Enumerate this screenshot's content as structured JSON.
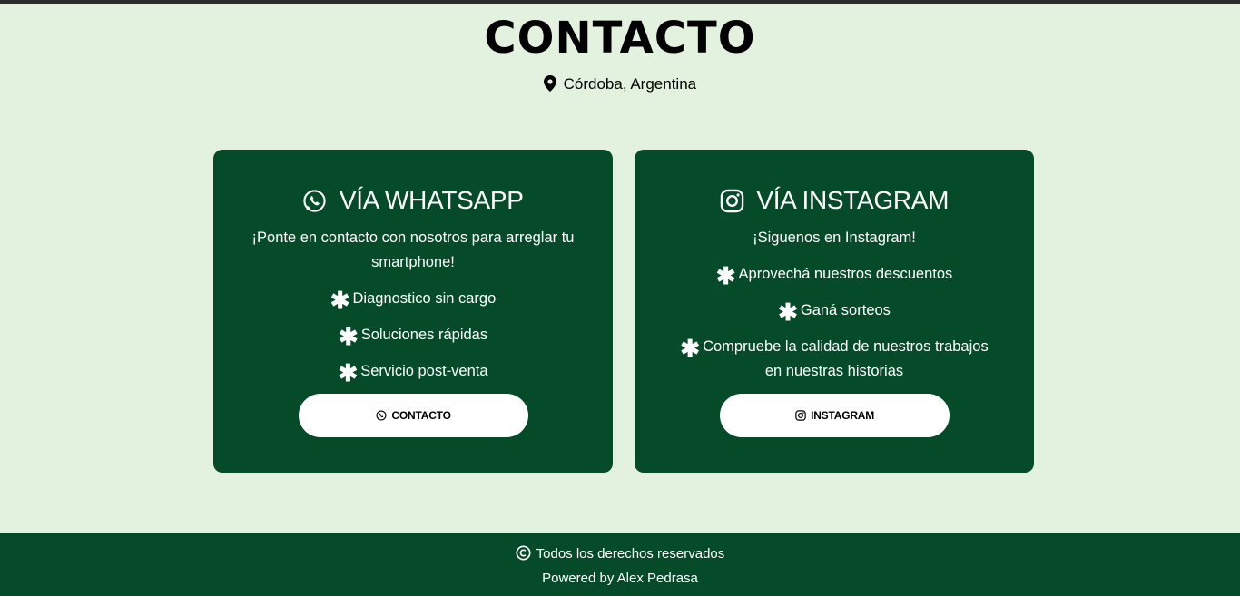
{
  "header": {
    "title": "CONTACTO",
    "location": "Córdoba, Argentina",
    "location_icon": "map-marker-icon"
  },
  "cards": [
    {
      "icon": "whatsapp-icon",
      "title": "VÍA WHATSAPP",
      "intro": "¡Ponte en contacto con nosotros para arreglar tu smartphone!",
      "items": [
        "Diagnostico sin cargo",
        "Soluciones rápidas",
        "Servicio post-venta"
      ],
      "button_label": "CONTACTO"
    },
    {
      "icon": "instagram-icon",
      "title": "VÍA INSTAGRAM",
      "intro": "¡Siguenos en Instagram!",
      "items": [
        "Aprovechá nuestros descuentos",
        "Ganá sorteos",
        "Compruebe la calidad de nuestros trabajos en nuestras historias"
      ],
      "button_label": "INSTAGRAM"
    }
  ],
  "footer": {
    "copyright": "Todos los derechos reservados",
    "copyright_icon": "copyright-icon",
    "powered_by": "Powered by Alex Pedrasa"
  },
  "colors": {
    "background": "#e3f1df",
    "card": "#054a29",
    "footer": "#054a29",
    "button": "#ffffff"
  }
}
